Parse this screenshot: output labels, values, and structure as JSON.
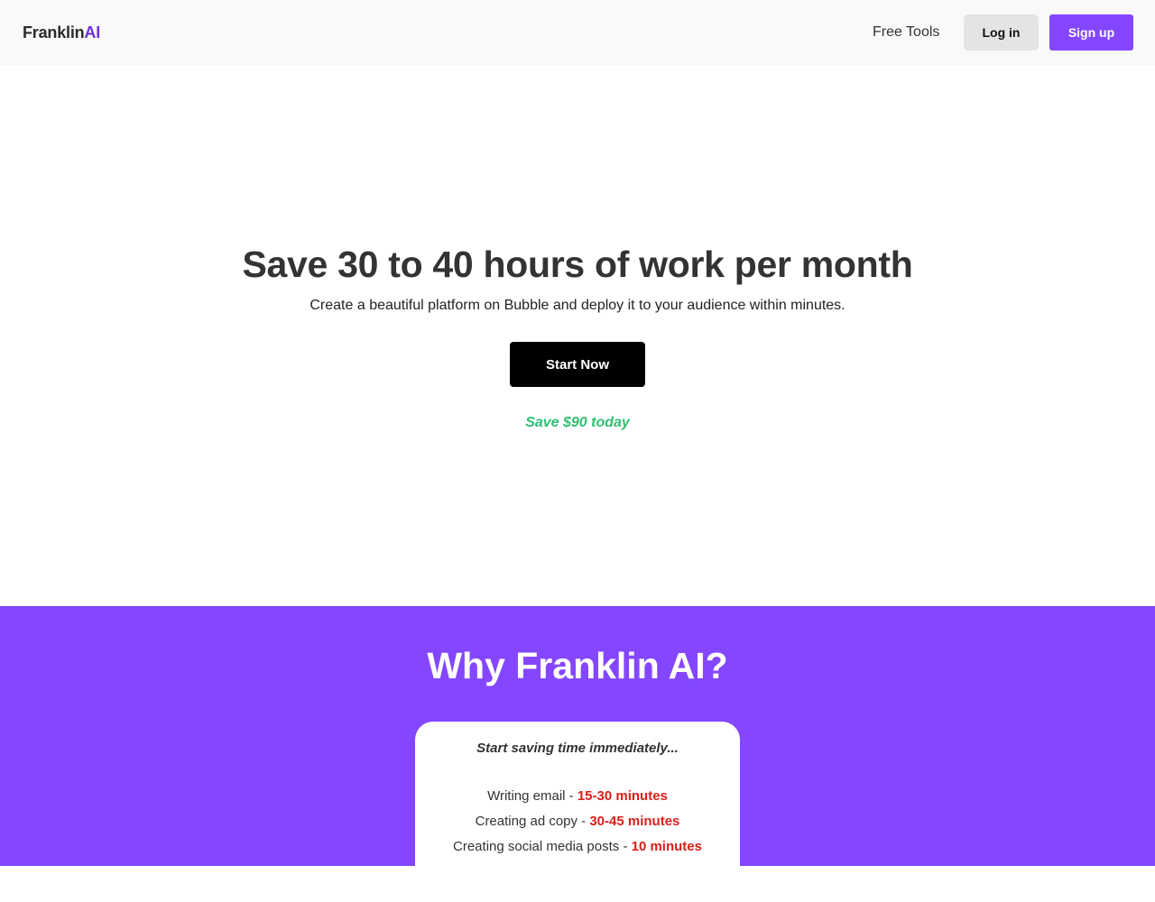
{
  "nav": {
    "logo_main": "Franklin",
    "logo_accent": "AI",
    "free_tools": "Free Tools",
    "login": "Log in",
    "signup": "Sign up"
  },
  "hero": {
    "title": "Save 30 to 40 hours of work per month",
    "subtitle": "Create a beautiful platform on Bubble and deploy it to your audience within minutes.",
    "cta": "Start Now",
    "save_note": "Save $90 today"
  },
  "why": {
    "title": "Why Franklin AI?",
    "card_heading": "Start saving time immediately...",
    "items": [
      {
        "task": "Writing email - ",
        "time": "15-30 minutes"
      },
      {
        "task": "Creating ad copy - ",
        "time": "30-45 minutes"
      },
      {
        "task": "Creating social media posts - ",
        "time": "10 minutes"
      }
    ]
  },
  "colors": {
    "brand_purple": "#8447ff",
    "logo_accent": "#6b2fd6",
    "save_green": "#2fbf71",
    "time_red": "#d91e18"
  }
}
